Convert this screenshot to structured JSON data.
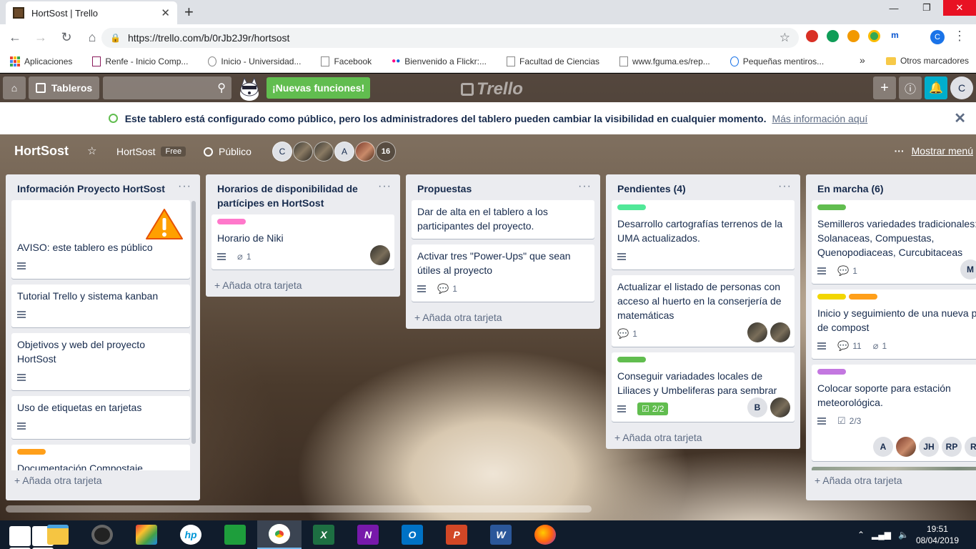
{
  "browser": {
    "tab_title": "HortSost | Trello",
    "url": "https://trello.com/b/0rJb2J9r/hortsost",
    "profile_initial": "C",
    "bookmarks": [
      {
        "label": "Aplicaciones"
      },
      {
        "label": "Renfe - Inicio Comp..."
      },
      {
        "label": "Inicio - Universidad..."
      },
      {
        "label": "Facebook"
      },
      {
        "label": "Bienvenido a Flickr:..."
      },
      {
        "label": "Facultad de Ciencias"
      },
      {
        "label": "www.fguma.es/rep..."
      },
      {
        "label": "Pequeñas mentiros..."
      }
    ],
    "bookmarks_more": "»",
    "other_bookmarks": "Otros marcadores"
  },
  "trello_header": {
    "boards_label": "Tableros",
    "new_features": "¡Nuevas funciones!",
    "logo_text": "Trello",
    "user_initial": "C"
  },
  "banner": {
    "text": "Este tablero está configurado como público, pero los administradores del tablero pueden cambiar la visibilidad en cualquier momento.",
    "link": "Más información aquí"
  },
  "board": {
    "name": "HortSost",
    "team": "HortSost",
    "team_badge": "Free",
    "visibility": "Público",
    "members": [
      "C",
      "",
      "",
      "A",
      ""
    ],
    "member_count": "16",
    "show_menu": "Mostrar menú"
  },
  "lists": [
    {
      "title": "Información Proyecto HortSost",
      "cards": [
        {
          "title": "AVISO: este tablero es público"
        },
        {
          "title": "Tutorial Trello y sistema kanban"
        },
        {
          "title": "Objetivos y web del proyecto HortSost"
        },
        {
          "title": "Uso de etiquetas en tarjetas"
        },
        {
          "title": "Documentación Compostaje"
        }
      ],
      "add_card": "+ Añada otra tarjeta"
    },
    {
      "title": "Horarios de disponibilidad de partícipes en HortSost",
      "cards": [
        {
          "title": "Horario de Niki",
          "attachments": "1"
        }
      ],
      "add_card": "+ Añada otra tarjeta"
    },
    {
      "title": "Propuestas",
      "cards": [
        {
          "title": "Dar de alta en el tablero a los participantes del proyecto."
        },
        {
          "title": "Activar tres \"Power-Ups\" que sean útiles al proyecto",
          "comments": "1"
        }
      ],
      "add_card": "+ Añada otra tarjeta"
    },
    {
      "title": "Pendientes (4)",
      "cards": [
        {
          "title": "Desarrollo cartografías terrenos de la UMA actualizados."
        },
        {
          "title": "Actualizar el listado de personas con acceso al huerto en la conserjería de matemáticas",
          "comments": "1"
        },
        {
          "title": "Conseguir variadades locales de Liliaces y Umbeliferas para sembrar",
          "checklist": "2/2",
          "member": "B"
        }
      ],
      "add_card": "+ Añada otra tarjeta"
    },
    {
      "title": "En marcha (6)",
      "cards": [
        {
          "title": "Semilleros variedades tradicionales: Solanaceas, Compuestas, Quenopodiaceas, Curcubitaceas",
          "comments": "1",
          "member": "M"
        },
        {
          "title": "Inicio y seguimiento de una nueva pila de compost",
          "comments": "11",
          "attachments": "1"
        },
        {
          "title": "Colocar soporte para estación meteorológica.",
          "checklist": "2/3",
          "members": [
            "A",
            "",
            "JH",
            "RP",
            "RI"
          ]
        }
      ],
      "add_card": "+ Añada otra tarjeta"
    }
  ],
  "taskbar": {
    "time": "19:51",
    "date": "08/04/2019"
  },
  "colors": {
    "label_green": "#61bd4f",
    "label_mint": "#51e898",
    "label_pink": "#ff78cb",
    "label_orange": "#ff9f1a",
    "label_yellow": "#f2d600",
    "label_purple": "#c377e0",
    "trello_list_bg": "#ebecf0"
  }
}
